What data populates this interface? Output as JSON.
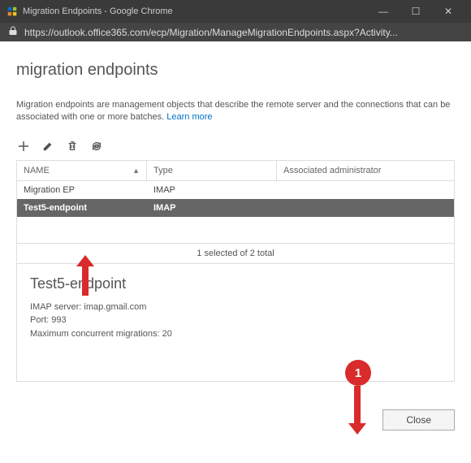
{
  "window": {
    "title": "Migration Endpoints - Google Chrome",
    "url": "https://outlook.office365.com/ecp/Migration/ManageMigrationEndpoints.aspx?Activity..."
  },
  "page": {
    "title": "migration endpoints",
    "description": "Migration endpoints are management objects that describe the remote server and the connections that can be associated with one or more batches. ",
    "learnMore": "Learn more"
  },
  "table": {
    "headers": {
      "name": "NAME",
      "type": "Type",
      "admin": "Associated administrator"
    },
    "rows": [
      {
        "name": "Migration EP",
        "type": "IMAP",
        "admin": "",
        "selected": false
      },
      {
        "name": "Test5-endpoint",
        "type": "IMAP",
        "admin": "",
        "selected": true
      }
    ],
    "status": "1 selected of 2 total"
  },
  "details": {
    "title": "Test5-endpoint",
    "server": "IMAP server: imap.gmail.com",
    "port": "Port: 993",
    "max": "Maximum concurrent migrations: 20"
  },
  "buttons": {
    "close": "Close"
  },
  "annotations": {
    "badge1": "1"
  }
}
